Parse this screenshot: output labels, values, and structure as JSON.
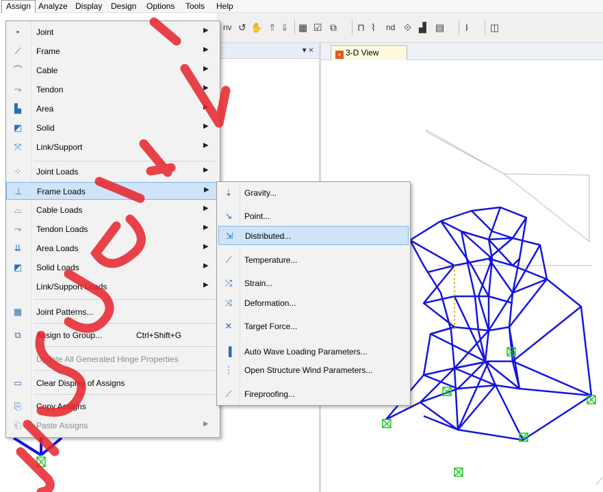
{
  "menubar": [
    "Assign",
    "Analyze",
    "Display",
    "Design",
    "Options",
    "Tools",
    "Help"
  ],
  "toolbar": {
    "nv": "nv",
    "nd": "nd",
    "t": "I"
  },
  "left_pane": {
    "close": "▾ ×"
  },
  "view_tab": {
    "label": "3-D View"
  },
  "assign_menu": [
    {
      "label": "Joint",
      "icon": "joint-icon",
      "glyph": "•",
      "arrow": true
    },
    {
      "label": "Frame",
      "icon": "frame-icon",
      "glyph": "⟋",
      "arrow": true
    },
    {
      "label": "Cable",
      "icon": "cable-icon",
      "glyph": "⌒",
      "arrow": true
    },
    {
      "label": "Tendon",
      "icon": "tendon-icon",
      "glyph": "⤳",
      "arrow": true
    },
    {
      "label": "Area",
      "icon": "area-icon",
      "glyph": "▙",
      "arrow": true
    },
    {
      "label": "Solid",
      "icon": "solid-icon",
      "glyph": "◩",
      "arrow": true
    },
    {
      "label": "Link/Support",
      "icon": "link-support-icon",
      "glyph": "⤧",
      "arrow": true
    },
    {
      "label": "Joint Loads",
      "icon": "joint-loads-icon",
      "glyph": "⁘",
      "arrow": true
    },
    {
      "label": "Frame Loads",
      "icon": "frame-loads-icon",
      "glyph": "⊥",
      "arrow": true
    },
    {
      "label": "Cable Loads",
      "icon": "cable-loads-icon",
      "glyph": "⌓",
      "arrow": true
    },
    {
      "label": "Tendon Loads",
      "icon": "tendon-loads-icon",
      "glyph": "⤳",
      "arrow": true
    },
    {
      "label": "Area Loads",
      "icon": "area-loads-icon",
      "glyph": "⇊",
      "arrow": true
    },
    {
      "label": "Solid Loads",
      "icon": "solid-loads-icon",
      "glyph": "◩",
      "arrow": true
    },
    {
      "label": "Link/Support Loads",
      "icon": "link-support-loads-icon",
      "glyph": "",
      "arrow": true
    },
    {
      "label": "Joint Patterns...",
      "icon": "joint-patterns-icon",
      "glyph": "▦",
      "arrow": false
    },
    {
      "label": "Assign to Group...",
      "shortcut": "Ctrl+Shift+G",
      "icon": "assign-group-icon",
      "glyph": "⧉",
      "arrow": false
    },
    {
      "label": "Update All Generated Hinge Properties",
      "icon": "",
      "glyph": "",
      "arrow": false,
      "disabled": true
    },
    {
      "label": "Clear Display of Assigns",
      "icon": "clear-display-icon",
      "glyph": "▭",
      "arrow": false
    },
    {
      "label": "Copy Assigns",
      "icon": "copy-assigns-icon",
      "glyph": "⎘",
      "arrow": false
    },
    {
      "label": "Paste Assigns",
      "icon": "paste-assigns-icon",
      "glyph": "⎗",
      "arrow": true,
      "disabled": true
    }
  ],
  "frame_loads_submenu": [
    {
      "label": "Gravity...",
      "icon": "gravity-icon",
      "glyph": "⇣"
    },
    {
      "label": "Point...",
      "icon": "point-load-icon",
      "glyph": "↘"
    },
    {
      "label": "Distributed...",
      "icon": "distributed-load-icon",
      "glyph": "⇲"
    },
    {
      "label": "Temperature...",
      "icon": "temperature-icon",
      "glyph": "⟋"
    },
    {
      "label": "Strain...",
      "icon": "strain-icon",
      "glyph": "⤭"
    },
    {
      "label": "Deformation...",
      "icon": "deformation-icon",
      "glyph": "⤨"
    },
    {
      "label": "Target Force...",
      "icon": "target-force-icon",
      "glyph": "✕"
    },
    {
      "label": "Auto Wave Loading Parameters...",
      "icon": "wave-loading-icon",
      "glyph": "▐"
    },
    {
      "label": "Open Structure Wind Parameters...",
      "icon": "wind-parameters-icon",
      "glyph": "⋮"
    },
    {
      "label": "Fireproofing...",
      "icon": "fireproofing-icon",
      "glyph": "⟋"
    }
  ],
  "colors": {
    "structure": "#1414e0",
    "support": "#1ec81e",
    "highlight": "#cfe4f8",
    "watermark": "#e8232b"
  }
}
